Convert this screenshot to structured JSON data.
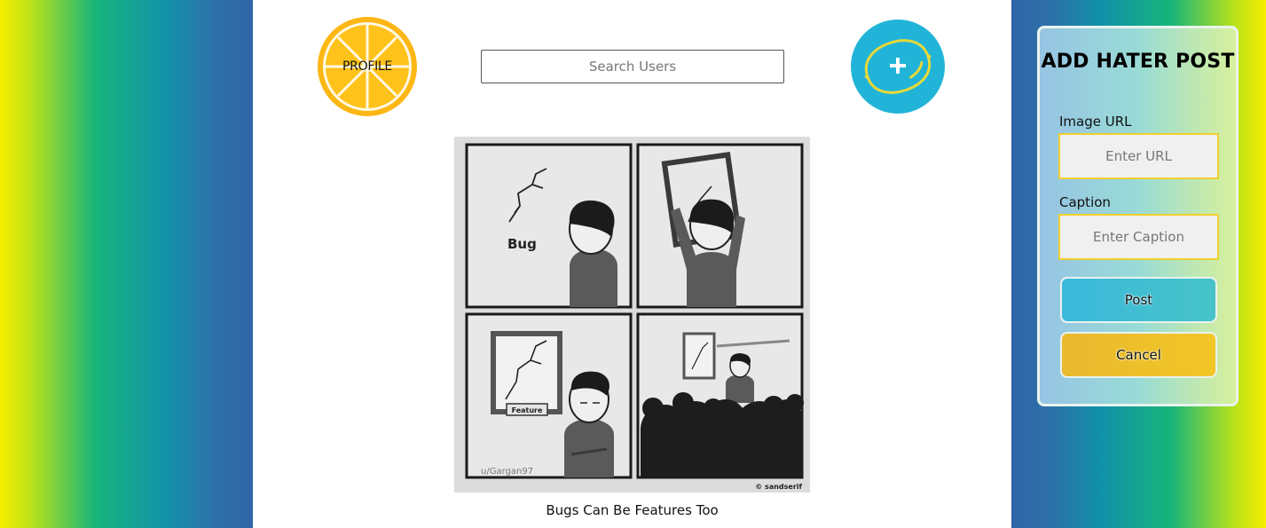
{
  "header": {
    "profile_label": "PROFILE",
    "search_placeholder": "Search Users",
    "add_icon": "lemon-plus-icon"
  },
  "post": {
    "image_alt": "Bugs Can Be Features Too",
    "comic_text": {
      "panel1_label": "Bug",
      "frame_label": "Feature",
      "credit_left": "u/Gargan97",
      "credit_right": "© sandserif"
    },
    "caption": "Bugs Can Be Features Too"
  },
  "panel": {
    "title": "ADD HATER POST",
    "image_label": "Image URL",
    "image_placeholder": "Enter URL",
    "caption_label": "Caption",
    "caption_placeholder": "Enter Caption",
    "post_label": "Post",
    "cancel_label": "Cancel"
  },
  "colors": {
    "lemon_orange": "#fdb714",
    "add_button": "#22b4d8",
    "input_border": "#f2cf2e",
    "post_button": "#3cb9dd",
    "cancel_button": "#efc22b"
  }
}
